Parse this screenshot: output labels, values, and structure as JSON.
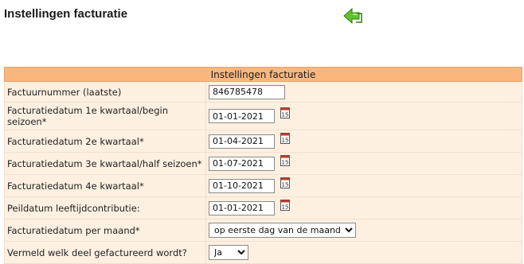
{
  "page": {
    "title": "Instellingen facturatie",
    "back_icon": "green-back-arrow-icon"
  },
  "table": {
    "header": "Instellingen facturatie",
    "rows": [
      {
        "label": "Factuurnummer (laatste)",
        "value": "846785478"
      },
      {
        "label": "Facturatiedatum 1e kwartaal/begin seizoen*",
        "value": "01-01-2021",
        "calendar_icon": "calendar-icon"
      },
      {
        "label": "Facturatiedatum 2e kwartaal*",
        "value": "01-04-2021",
        "calendar_icon": "calendar-icon"
      },
      {
        "label": "Facturatiedatum 3e kwartaal/half seizoen*",
        "value": "01-07-2021",
        "calendar_icon": "calendar-icon"
      },
      {
        "label": "Facturatiedatum 4e kwartaal*",
        "value": "01-10-2021",
        "calendar_icon": "calendar-icon"
      },
      {
        "label": "Peildatum leeftijdcontributie:",
        "value": "01-01-2021",
        "calendar_icon": "calendar-icon"
      },
      {
        "label": "Facturatiedatum per maand*",
        "selected": "op eerste dag van de maand"
      },
      {
        "label": "Vermeld welk deel gefactureerd wordt?",
        "selected": "Ja"
      }
    ]
  },
  "colors": {
    "header_bg": "#f9b77e",
    "row_bg": "#fdf0e0",
    "icon_green": "#5fbf2c"
  }
}
